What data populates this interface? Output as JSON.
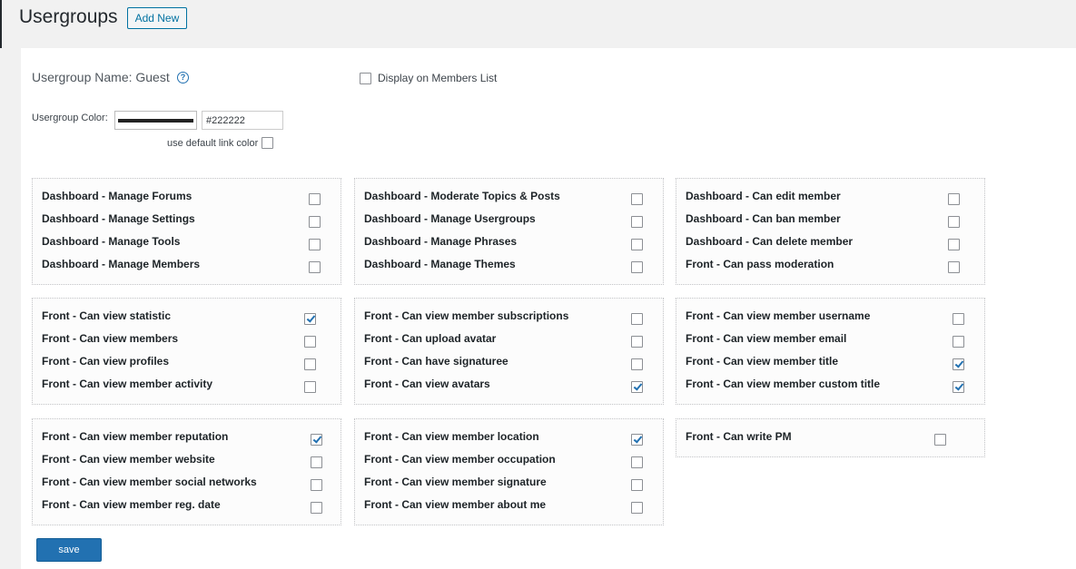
{
  "header": {
    "title": "Usergroups",
    "add_new_label": "Add New"
  },
  "form": {
    "name_label": "Usergroup Name: Guest",
    "display_label": "Display on Members List",
    "display_checked": false,
    "color_label": "Usergroup Color:",
    "color_value": "#222222",
    "default_link_label": "use default link color",
    "default_link_checked": false
  },
  "groups": [
    {
      "items": [
        {
          "label": "Dashboard - Manage Forums",
          "checked": false
        },
        {
          "label": "Dashboard - Manage Settings",
          "checked": false
        },
        {
          "label": "Dashboard - Manage Tools",
          "checked": false
        },
        {
          "label": "Dashboard - Manage Members",
          "checked": false
        }
      ]
    },
    {
      "items": [
        {
          "label": "Dashboard - Moderate Topics & Posts",
          "checked": false
        },
        {
          "label": "Dashboard - Manage Usergroups",
          "checked": false
        },
        {
          "label": "Dashboard - Manage Phrases",
          "checked": false
        },
        {
          "label": "Dashboard - Manage Themes",
          "checked": false
        }
      ]
    },
    {
      "items": [
        {
          "label": "Dashboard - Can edit member",
          "checked": false
        },
        {
          "label": "Dashboard - Can ban member",
          "checked": false
        },
        {
          "label": "Dashboard - Can delete member",
          "checked": false
        },
        {
          "label": "Front - Can pass moderation",
          "checked": false
        }
      ]
    },
    {
      "items": [
        {
          "label": "Front - Can view statistic",
          "checked": true
        },
        {
          "label": "Front - Can view members",
          "checked": false
        },
        {
          "label": "Front - Can view profiles",
          "checked": false
        },
        {
          "label": "Front - Can view member activity",
          "checked": false
        }
      ]
    },
    {
      "items": [
        {
          "label": "Front - Can view member subscriptions",
          "checked": false
        },
        {
          "label": "Front - Can upload avatar",
          "checked": false
        },
        {
          "label": "Front - Can have signaturee",
          "checked": false
        },
        {
          "label": "Front - Can view avatars",
          "checked": true
        }
      ]
    },
    {
      "items": [
        {
          "label": "Front - Can view member username",
          "checked": false
        },
        {
          "label": "Front - Can view member email",
          "checked": false
        },
        {
          "label": "Front - Can view member title",
          "checked": true
        },
        {
          "label": "Front - Can view member custom title",
          "checked": true
        }
      ]
    },
    {
      "items": [
        {
          "label": "Front - Can view member reputation",
          "checked": true
        },
        {
          "label": "Front - Can view member website",
          "checked": false
        },
        {
          "label": "Front - Can view member social networks",
          "checked": false
        },
        {
          "label": "Front - Can view member reg. date",
          "checked": false
        }
      ]
    },
    {
      "items": [
        {
          "label": "Front - Can view member location",
          "checked": true
        },
        {
          "label": "Front - Can view member occupation",
          "checked": false
        },
        {
          "label": "Front - Can view member signature",
          "checked": false
        },
        {
          "label": "Front - Can view member about me",
          "checked": false
        }
      ]
    },
    {
      "items": [
        {
          "label": "Front - Can write PM",
          "checked": false
        }
      ]
    }
  ],
  "save_label": "save"
}
